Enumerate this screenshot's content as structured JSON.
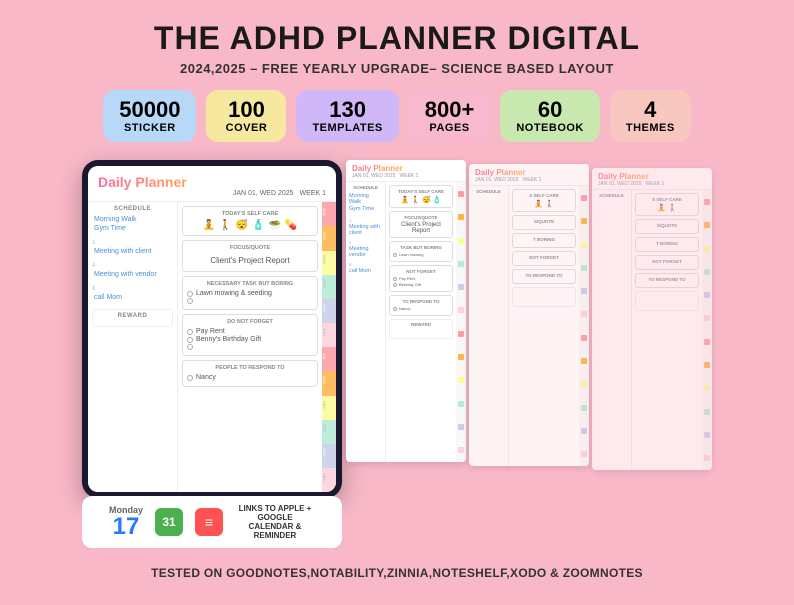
{
  "header": {
    "main_title": "THE ADHD PLANNER DIGITAL",
    "subtitle": "2024,2025 – FREE YEARLY UPGRADE– SCIENCE BASED LAYOUT"
  },
  "badges": [
    {
      "id": "sticker",
      "number": "50000",
      "label": "STICKER",
      "color_class": "badge-blue"
    },
    {
      "id": "cover",
      "number": "100",
      "label": "COVER",
      "color_class": "badge-yellow"
    },
    {
      "id": "templates",
      "number": "130",
      "label": "TEMPLATES",
      "color_class": "badge-purple"
    },
    {
      "id": "pages",
      "number": "800+",
      "label": "PAGES",
      "color_class": "badge-pink"
    },
    {
      "id": "notebook",
      "number": "60",
      "label": "NOTEBOOK",
      "color_class": "badge-green"
    },
    {
      "id": "themes",
      "number": "4",
      "label": "THEMES",
      "color_class": "badge-coral"
    }
  ],
  "planner": {
    "title": "Daily Planner",
    "date": "JAN 01, WED 2025",
    "week": "WEEK 1",
    "schedule_header": "SCHEDULE",
    "schedule_items": [
      {
        "time": "8",
        "text": "Morning Walk"
      },
      {
        "text": "Gym Time"
      },
      {
        "time": "1",
        "text": "Meeting with client"
      },
      {
        "time": "4",
        "text": "Meeting with vendor"
      },
      {
        "time": "8",
        "text": "call Mom"
      }
    ],
    "self_care_header": "TODAY'S SELF CARE",
    "self_care_icons": [
      "🧘",
      "🚶",
      "😴",
      "🧴",
      "🥗",
      "💊"
    ],
    "focus_header": "FOCUS/QUOTE",
    "focus_text": "Client's Project Report",
    "boring_header": "NECESSARY TASK BUT BORING",
    "boring_items": [
      "Lawn mowing & seeding"
    ],
    "forget_header": "DO NOT FORGET",
    "forget_items": [
      "Pay Rent",
      "Benny's Birthday Gift"
    ],
    "respond_header": "PEOPLE TO RESPOND TO",
    "respond_items": [
      "Nancy"
    ],
    "reward_header": "REWARD",
    "tabs": [
      "JAN",
      "FEB",
      "MAR",
      "APR",
      "MAY",
      "JUN",
      "JUL",
      "AUG",
      "SEP",
      "OCT",
      "NOV",
      "DEC"
    ],
    "tab_colors": [
      "#FF9AA2",
      "#FFB347",
      "#FDFD96",
      "#B5EAD7",
      "#C7CEEA",
      "#FFD1DC",
      "#FF9AA2",
      "#FFB347",
      "#FDFD96",
      "#B5EAD7",
      "#C7CEEA",
      "#FFD1DC"
    ]
  },
  "bottom_bar": {
    "day_label": "Monday",
    "day_number": "17",
    "links_text": "LINKS TO APPLE + GOOGLE CALENDAR & REMINDER"
  },
  "footer": {
    "text": "TESTED ON GOODNOTES,NOTABILITY,ZINNIA,NOTESHELF,XODO & ZOOMNOTES"
  }
}
